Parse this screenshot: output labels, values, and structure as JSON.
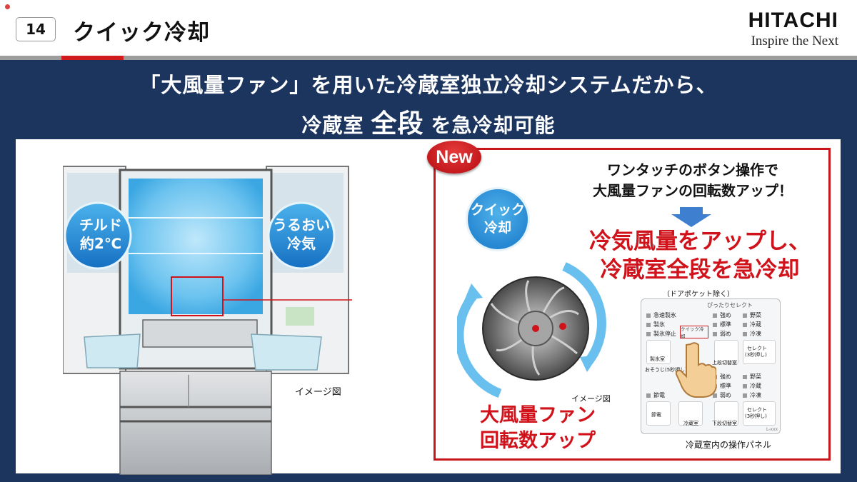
{
  "header": {
    "slide_number": "14",
    "title": "クイック冷却",
    "logo_main": "HITACHI",
    "logo_tagline": "Inspire the Next"
  },
  "headline": {
    "line1": "「大風量ファン」を用いた冷蔵室独立冷却システムだから、",
    "line2_prefix": "冷蔵室",
    "line2_emphasis": "全段",
    "line2_suffix": "を急冷却可能"
  },
  "fridge": {
    "chilled_label_1": "チルド",
    "chilled_label_2": "約2℃",
    "moist_label_1": "うるおい",
    "moist_label_2": "冷気",
    "image_note": "イメージ図"
  },
  "feature": {
    "new_badge": "New",
    "quick_line1": "クイック",
    "quick_line2": "冷却",
    "onetouch_line1": "ワンタッチのボタン操作で",
    "onetouch_line2": "大風量ファンの回転数アップ！",
    "headline_line1": "冷気風量をアップし、",
    "headline_line2": "冷蔵室全段を急冷却",
    "door_note": "（ドアポケット除く）",
    "fan_image_note": "イメージ図",
    "fan_label_line1": "大風量ファン",
    "fan_label_line2": "回転数アップ"
  },
  "control_panel": {
    "caption": "冷蔵室内の操作パネル",
    "top_header": "ぴったりセレクト",
    "left_top": [
      "急速製氷",
      "製氷",
      "製氷停止"
    ],
    "select_top_a": [
      "強め",
      "標準",
      "弱め"
    ],
    "select_top_b": [
      "野菜",
      "冷蔵",
      "冷凍"
    ],
    "quick_button": "クイック冷却",
    "ice_room_label": "製氷室",
    "clean_label": "おそうじ(5秒押し)",
    "upper_switch": "上段切替室",
    "select_button_1": "セレクト",
    "select_button_2": "(3秒押し)",
    "mid_left_1": "節電",
    "mid_left_2": "節電",
    "select_bottom_a": [
      "強め",
      "標準",
      "弱め"
    ],
    "select_bottom_b": [
      "野菜",
      "冷蔵",
      "冷凍"
    ],
    "fridge_room": "冷蔵室",
    "lower_switch": "下段切替室",
    "model": "L-xxx"
  },
  "colors": {
    "navy": "#1c355e",
    "accent_red": "#d0121b",
    "cool_blue": "#1777c9"
  }
}
